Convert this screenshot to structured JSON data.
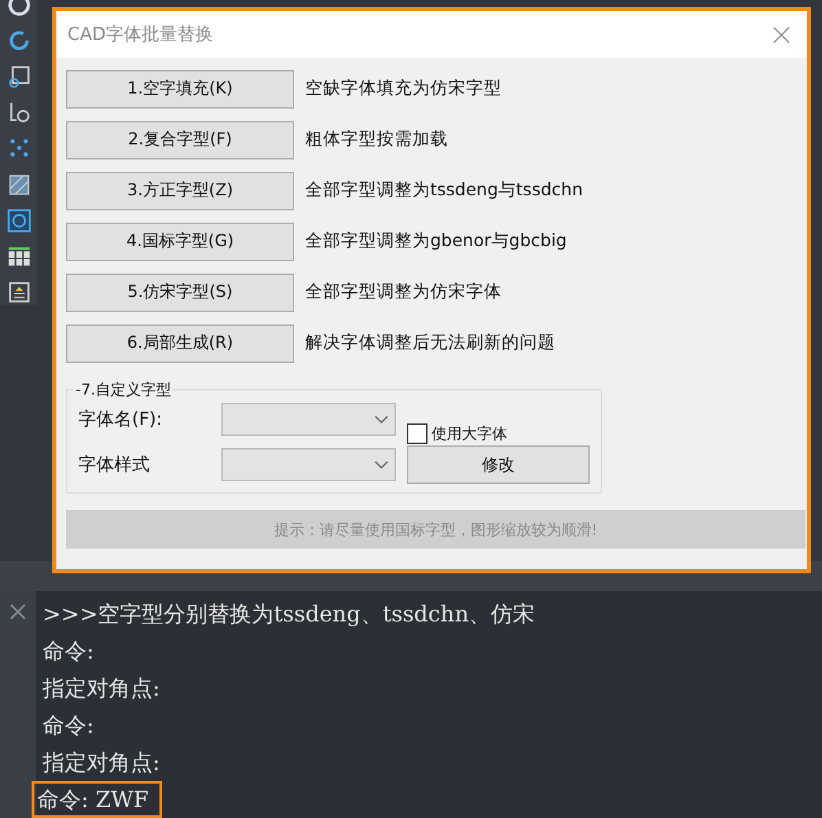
{
  "dialog": {
    "title": "CAD字体批量替换",
    "highlighted": true,
    "actions": [
      {
        "label": "1.空字填充(K)",
        "description": "空缺字体填充为仿宋字型"
      },
      {
        "label": "2.复合字型(F)",
        "description": "粗体字型按需加载"
      },
      {
        "label": "3.方正字型(Z)",
        "description": "全部字型调整为tssdeng与tssdchn"
      },
      {
        "label": "4.国标字型(G)",
        "description": "全部字型调整为gbenor与gbcbig"
      },
      {
        "label": "5.仿宋字型(S)",
        "description": "全部字型调整为仿宋字体"
      },
      {
        "label": "6.局部生成(R)",
        "description": "解决字体调整后无法刷新的问题"
      }
    ],
    "custom_group": {
      "legend": "-7.自定义字型",
      "font_name": {
        "label": "字体名(F):"
      },
      "font_style": {
        "label": "字体样式"
      },
      "big_font_checkbox": {
        "label": "使用大字体",
        "checked": false
      },
      "modify_button": "修改"
    },
    "hint": {
      "text": "提示：请尽量使用国标字型，图形缩放较为顺滑!",
      "disabled": true
    }
  },
  "console": {
    "lines": [
      {
        "text": ">>>空字型分别替换为tssdeng、tssdchn、仿宋",
        "highlighted": false
      },
      {
        "text": "命令:",
        "highlighted": false
      },
      {
        "text": "指定对角点:",
        "highlighted": false
      },
      {
        "text": "命令:",
        "highlighted": false
      },
      {
        "text": "指定对角点:",
        "highlighted": false
      },
      {
        "text": "命令: ZWF",
        "highlighted": true
      }
    ]
  }
}
